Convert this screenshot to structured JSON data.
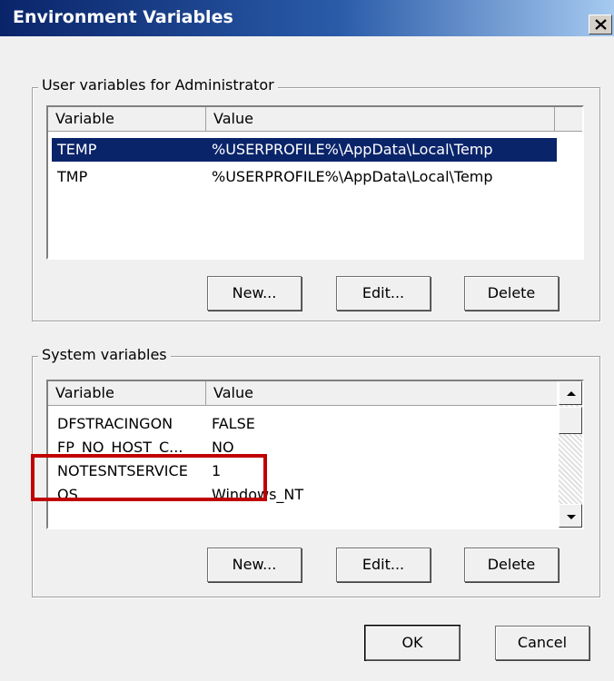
{
  "window": {
    "title": "Environment Variables",
    "close_glyph": "✕"
  },
  "user_vars": {
    "group_label": "User variables for Administrator",
    "columns": [
      "Variable",
      "Value"
    ],
    "rows": [
      {
        "variable": "TEMP",
        "value": "%USERPROFILE%\\AppData\\Local\\Temp",
        "selected": true
      },
      {
        "variable": "TMP",
        "value": "%USERPROFILE%\\AppData\\Local\\Temp",
        "selected": false
      }
    ],
    "buttons": {
      "new": "New...",
      "edit": "Edit...",
      "delete": "Delete"
    }
  },
  "system_vars": {
    "group_label": "System variables",
    "columns": [
      "Variable",
      "Value"
    ],
    "rows": [
      {
        "variable": "DFSTRACINGON",
        "value": "FALSE"
      },
      {
        "variable": "FP_NO_HOST_C...",
        "value": "NO"
      },
      {
        "variable": "NOTESNTSERVICE",
        "value": "1"
      },
      {
        "variable": "OS",
        "value": "Windows_NT"
      }
    ],
    "buttons": {
      "new": "New...",
      "edit": "Edit...",
      "delete": "Delete"
    },
    "highlight_color": "#c00000"
  },
  "footer": {
    "ok": "OK",
    "cancel": "Cancel"
  }
}
